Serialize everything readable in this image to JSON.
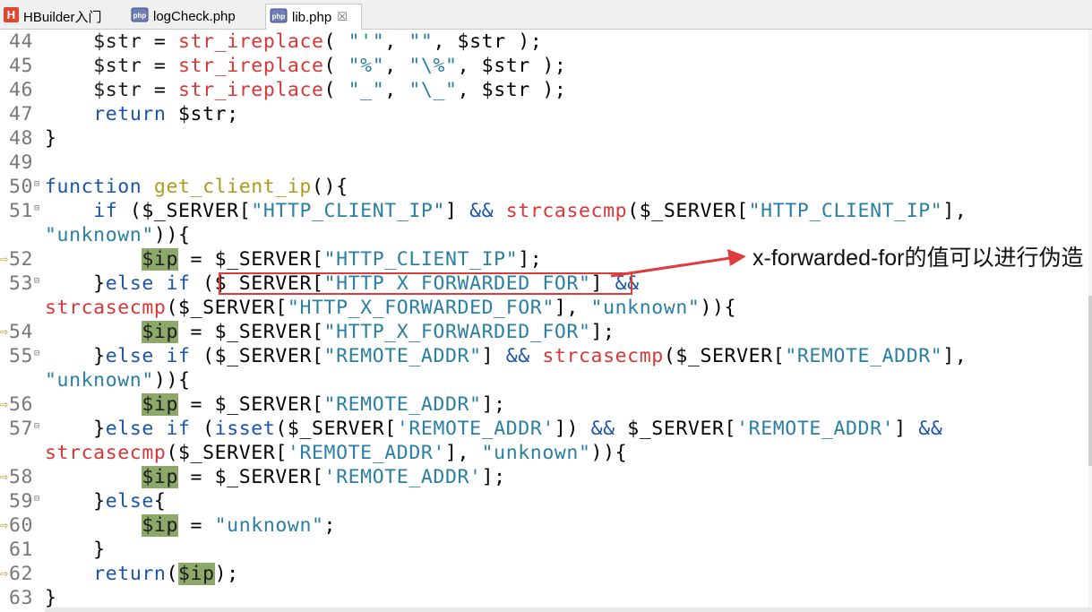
{
  "tabs": [
    {
      "label": "HBuilder入门",
      "icon": "hbuilder-logo-icon",
      "active": false
    },
    {
      "label": "logCheck.php",
      "icon": "php-file-icon",
      "active": false
    },
    {
      "label": "lib.php",
      "icon": "php-file-icon",
      "active": true,
      "close": "☒"
    }
  ],
  "editor": {
    "lines": [
      {
        "num": "44",
        "marker": "",
        "fold": ""
      },
      {
        "num": "45",
        "marker": "",
        "fold": ""
      },
      {
        "num": "46",
        "marker": "",
        "fold": ""
      },
      {
        "num": "47",
        "marker": "",
        "fold": ""
      },
      {
        "num": "48",
        "marker": "",
        "fold": ""
      },
      {
        "num": "49",
        "marker": "",
        "fold": ""
      },
      {
        "num": "50",
        "marker": "",
        "fold": "⊟"
      },
      {
        "num": "51",
        "marker": "",
        "fold": "⊟"
      },
      {
        "num": "",
        "marker": "",
        "fold": ""
      },
      {
        "num": "52",
        "marker": "⇨",
        "fold": ""
      },
      {
        "num": "53",
        "marker": "",
        "fold": "⊟"
      },
      {
        "num": "",
        "marker": "",
        "fold": ""
      },
      {
        "num": "54",
        "marker": "⇨",
        "fold": ""
      },
      {
        "num": "55",
        "marker": "",
        "fold": "⊟"
      },
      {
        "num": "",
        "marker": "",
        "fold": ""
      },
      {
        "num": "56",
        "marker": "⇨",
        "fold": ""
      },
      {
        "num": "57",
        "marker": "",
        "fold": "⊟"
      },
      {
        "num": "",
        "marker": "",
        "fold": ""
      },
      {
        "num": "58",
        "marker": "⇨",
        "fold": ""
      },
      {
        "num": "59",
        "marker": "",
        "fold": "⊟"
      },
      {
        "num": "60",
        "marker": "⇨",
        "fold": ""
      },
      {
        "num": "61",
        "marker": "",
        "fold": ""
      },
      {
        "num": "62",
        "marker": "⇨",
        "fold": ""
      },
      {
        "num": "63",
        "marker": "",
        "fold": ""
      }
    ],
    "code": [
      [
        [
          "    ",
          ""
        ],
        [
          "$str",
          "var"
        ],
        [
          " = ",
          ""
        ],
        [
          "str_ireplace",
          "fn"
        ],
        [
          "( ",
          ""
        ],
        [
          "\"'\"",
          "str"
        ],
        [
          ", ",
          ""
        ],
        [
          "\"\"",
          "str"
        ],
        [
          ", $str );",
          ""
        ]
      ],
      [
        [
          "    ",
          ""
        ],
        [
          "$str",
          "var"
        ],
        [
          " = ",
          ""
        ],
        [
          "str_ireplace",
          "fn"
        ],
        [
          "( ",
          ""
        ],
        [
          "\"%\"",
          "str"
        ],
        [
          ", ",
          ""
        ],
        [
          "\"\\%\"",
          "str"
        ],
        [
          ", $str );",
          ""
        ]
      ],
      [
        [
          "    ",
          ""
        ],
        [
          "$str",
          "var"
        ],
        [
          " = ",
          ""
        ],
        [
          "str_ireplace",
          "fn"
        ],
        [
          "( ",
          ""
        ],
        [
          "\"_\"",
          "str"
        ],
        [
          ", ",
          ""
        ],
        [
          "\"\\_\"",
          "str"
        ],
        [
          ", $str );",
          ""
        ]
      ],
      [
        [
          "    ",
          ""
        ],
        [
          "return",
          "kw"
        ],
        [
          " $str;",
          ""
        ]
      ],
      [
        [
          "}",
          ""
        ]
      ],
      [
        [
          "",
          ""
        ]
      ],
      [
        [
          "function",
          "kw"
        ],
        [
          " ",
          ""
        ],
        [
          "get_client_ip",
          "fnname"
        ],
        [
          "(){",
          ""
        ]
      ],
      [
        [
          "    ",
          ""
        ],
        [
          "if",
          "kw"
        ],
        [
          " ($_SERVER[",
          ""
        ],
        [
          "\"HTTP_CLIENT_IP\"",
          "str"
        ],
        [
          "] ",
          ""
        ],
        [
          "&&",
          "kw"
        ],
        [
          " ",
          ""
        ],
        [
          "strcasecmp",
          "fn"
        ],
        [
          "($_SERVER[",
          ""
        ],
        [
          "\"HTTP_CLIENT_IP\"",
          "str"
        ],
        [
          "],",
          ""
        ]
      ],
      [
        [
          "\"unknown\"",
          "str"
        ],
        [
          ")){",
          ""
        ]
      ],
      [
        [
          "        ",
          ""
        ],
        [
          "$ip",
          "hl"
        ],
        [
          " = $_SERVER[",
          ""
        ],
        [
          "\"HTTP_CLIENT_IP\"",
          "str"
        ],
        [
          "];",
          ""
        ]
      ],
      [
        [
          "    }",
          ""
        ],
        [
          "else",
          "kw"
        ],
        [
          " ",
          ""
        ],
        [
          "if",
          "kw"
        ],
        [
          " ($_SERVER[",
          ""
        ],
        [
          "\"HTTP_X_FORWARDED_FOR\"",
          "str"
        ],
        [
          "] ",
          ""
        ],
        [
          "&&",
          "kw"
        ]
      ],
      [
        [
          "strcasecmp",
          "fn"
        ],
        [
          "($_SERVER[",
          ""
        ],
        [
          "\"HTTP_X_FORWARDED_FOR\"",
          "str"
        ],
        [
          "], ",
          ""
        ],
        [
          "\"unknown\"",
          "str"
        ],
        [
          ")){",
          ""
        ]
      ],
      [
        [
          "        ",
          ""
        ],
        [
          "$ip",
          "hl"
        ],
        [
          " = $_SERVER[",
          ""
        ],
        [
          "\"HTTP_X_FORWARDED_FOR\"",
          "str"
        ],
        [
          "];",
          ""
        ]
      ],
      [
        [
          "    }",
          ""
        ],
        [
          "else",
          "kw"
        ],
        [
          " ",
          ""
        ],
        [
          "if",
          "kw"
        ],
        [
          " ($_SERVER[",
          ""
        ],
        [
          "\"REMOTE_ADDR\"",
          "str"
        ],
        [
          "] ",
          ""
        ],
        [
          "&&",
          "kw"
        ],
        [
          " ",
          ""
        ],
        [
          "strcasecmp",
          "fn"
        ],
        [
          "($_SERVER[",
          ""
        ],
        [
          "\"REMOTE_ADDR\"",
          "str"
        ],
        [
          "],",
          ""
        ]
      ],
      [
        [
          "\"unknown\"",
          "str"
        ],
        [
          ")){",
          ""
        ]
      ],
      [
        [
          "        ",
          ""
        ],
        [
          "$ip",
          "hl"
        ],
        [
          " = $_SERVER[",
          ""
        ],
        [
          "\"REMOTE_ADDR\"",
          "str"
        ],
        [
          "];",
          ""
        ]
      ],
      [
        [
          "    }",
          ""
        ],
        [
          "else",
          "kw"
        ],
        [
          " ",
          ""
        ],
        [
          "if",
          "kw"
        ],
        [
          " (",
          ""
        ],
        [
          "isset",
          "kw"
        ],
        [
          "($_SERVER[",
          ""
        ],
        [
          "'REMOTE_ADDR'",
          "str"
        ],
        [
          "]) ",
          ""
        ],
        [
          "&&",
          "kw"
        ],
        [
          " $_SERVER[",
          ""
        ],
        [
          "'REMOTE_ADDR'",
          "str"
        ],
        [
          "] ",
          ""
        ],
        [
          "&&",
          "kw"
        ]
      ],
      [
        [
          "strcasecmp",
          "fn"
        ],
        [
          "($_SERVER[",
          ""
        ],
        [
          "'REMOTE_ADDR'",
          "str"
        ],
        [
          "], ",
          ""
        ],
        [
          "\"unknown\"",
          "str"
        ],
        [
          ")){",
          ""
        ]
      ],
      [
        [
          "        ",
          ""
        ],
        [
          "$ip",
          "hl"
        ],
        [
          " = $_SERVER[",
          ""
        ],
        [
          "'REMOTE_ADDR'",
          "str"
        ],
        [
          "];",
          ""
        ]
      ],
      [
        [
          "    }",
          ""
        ],
        [
          "else",
          "kw"
        ],
        [
          "{",
          ""
        ]
      ],
      [
        [
          "        ",
          ""
        ],
        [
          "$ip",
          "hl"
        ],
        [
          " = ",
          ""
        ],
        [
          "\"unknown\"",
          "str"
        ],
        [
          ";",
          ""
        ]
      ],
      [
        [
          "    }",
          ""
        ]
      ],
      [
        [
          "    ",
          ""
        ],
        [
          "return",
          "kw"
        ],
        [
          "(",
          ""
        ],
        [
          "$ip",
          "hl"
        ],
        [
          ");",
          ""
        ]
      ],
      [
        [
          "}",
          ""
        ]
      ]
    ]
  },
  "annotation": {
    "text": "x-forwarded-for的值可以进行伪造",
    "color": "#e03b3b"
  },
  "colors": {
    "keyword": "#1a54ad",
    "function_call": "#d93737",
    "function_name": "#b0991a",
    "string": "#2a7fa3",
    "highlight": "#8da96a",
    "line_number": "#787878"
  }
}
